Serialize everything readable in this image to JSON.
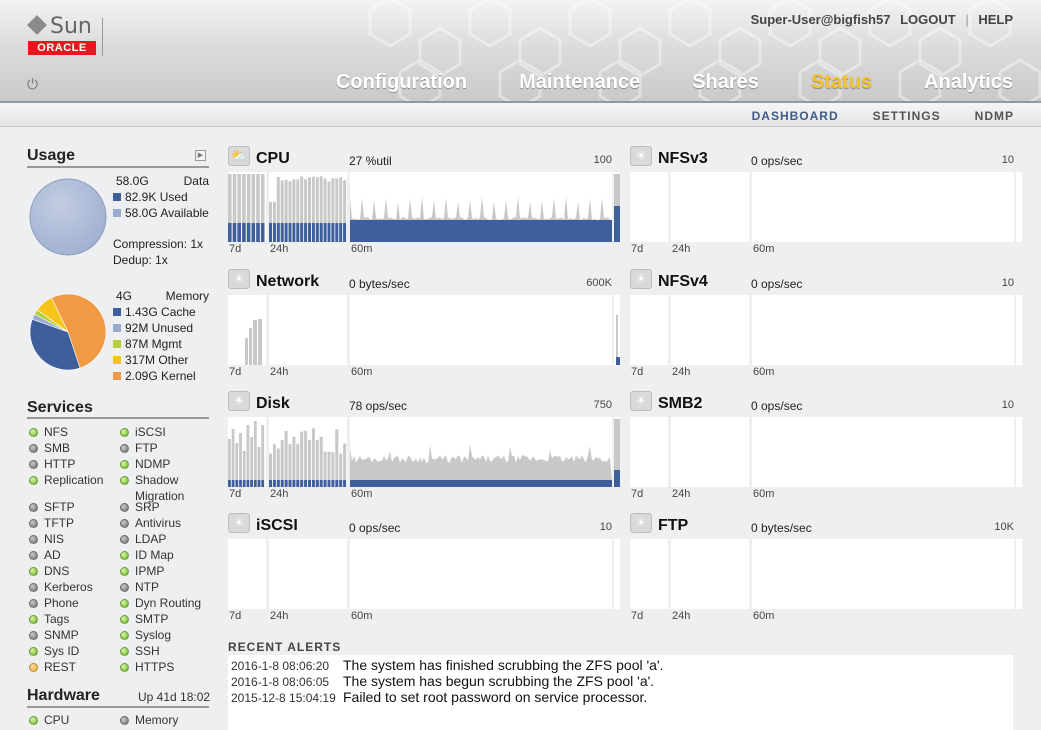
{
  "header": {
    "logo_top": "Sun",
    "logo_bottom": "ORACLE",
    "user": "Super-User@bigfish57",
    "logout": "LOGOUT",
    "help": "HELP",
    "separator": "|",
    "power_icon": "power-icon",
    "nav": [
      {
        "label": "Configuration",
        "active": false
      },
      {
        "label": "Maintenance",
        "active": false
      },
      {
        "label": "Shares",
        "active": false
      },
      {
        "label": "Status",
        "active": true
      },
      {
        "label": "Analytics",
        "active": false
      }
    ],
    "subnav": [
      {
        "label": "DASHBOARD",
        "active": true
      },
      {
        "label": "SETTINGS",
        "active": false
      },
      {
        "label": "NDMP",
        "active": false
      }
    ]
  },
  "usage": {
    "title": "Usage",
    "data": {
      "total": "58.0G",
      "label": "Data",
      "used": "82.9K Used",
      "available": "58.0G Available",
      "compression": "Compression: 1x",
      "dedup": "Dedup: 1x"
    },
    "memory": {
      "total": "4G",
      "label": "Memory",
      "items": [
        {
          "label": "1.43G Cache",
          "value": 1.43,
          "color": "#3e5f9c"
        },
        {
          "label": "92M Unused",
          "value": 0.092,
          "color": "#99abcf"
        },
        {
          "label": "87M Mgmt",
          "value": 0.087,
          "color": "#b6cf3a"
        },
        {
          "label": "317M Other",
          "value": 0.317,
          "color": "#f6c51c"
        },
        {
          "label": "2.09G Kernel",
          "value": 2.09,
          "color": "#f19a46"
        }
      ]
    }
  },
  "services": {
    "title": "Services",
    "left": [
      {
        "label": "NFS",
        "status": "green"
      },
      {
        "label": "SMB",
        "status": "gray"
      },
      {
        "label": "HTTP",
        "status": "gray"
      },
      {
        "label": "Replication",
        "status": "green"
      },
      {
        "label": "SFTP",
        "status": "gray"
      },
      {
        "label": "TFTP",
        "status": "gray"
      },
      {
        "label": "NIS",
        "status": "gray"
      },
      {
        "label": "AD",
        "status": "gray"
      },
      {
        "label": "DNS",
        "status": "green"
      },
      {
        "label": "Kerberos",
        "status": "gray"
      },
      {
        "label": "Phone",
        "status": "gray"
      },
      {
        "label": "Tags",
        "status": "green"
      },
      {
        "label": "SNMP",
        "status": "gray"
      },
      {
        "label": "Sys ID",
        "status": "green"
      },
      {
        "label": "REST",
        "status": "orange"
      }
    ],
    "right": [
      {
        "label": "iSCSI",
        "status": "green"
      },
      {
        "label": "FTP",
        "status": "gray"
      },
      {
        "label": "NDMP",
        "status": "green"
      },
      {
        "label": "Shadow",
        "label2": "Migration",
        "status": "green"
      },
      {
        "label": "SRP",
        "status": "gray"
      },
      {
        "label": "Antivirus",
        "status": "gray"
      },
      {
        "label": "LDAP",
        "status": "gray"
      },
      {
        "label": "ID Map",
        "status": "green"
      },
      {
        "label": "IPMP",
        "status": "green"
      },
      {
        "label": "NTP",
        "status": "gray"
      },
      {
        "label": "Dyn Routing",
        "status": "green"
      },
      {
        "label": "SMTP",
        "status": "green"
      },
      {
        "label": "Syslog",
        "status": "green"
      },
      {
        "label": "SSH",
        "status": "green"
      },
      {
        "label": "HTTPS",
        "status": "green"
      }
    ]
  },
  "hardware": {
    "title": "Hardware",
    "uptime": "Up 41d 18:02",
    "items": [
      {
        "label": "CPU",
        "status": "green"
      },
      {
        "label": "Memory",
        "status": "gray"
      }
    ]
  },
  "widgets": [
    {
      "key": "cpu",
      "icon": "partly-cloudy-icon",
      "title": "CPU",
      "value": "27 %util",
      "max": "100",
      "labels": [
        "7d",
        "24h",
        "60m"
      ]
    },
    {
      "key": "nfsv3",
      "icon": "sun-icon",
      "title": "NFSv3",
      "value": "0 ops/sec",
      "max": "10",
      "labels": [
        "7d",
        "24h",
        "60m"
      ]
    },
    {
      "key": "network",
      "icon": "sun-icon",
      "title": "Network",
      "value": "0 bytes/sec",
      "max": "600K",
      "labels": [
        "7d",
        "24h",
        "60m"
      ]
    },
    {
      "key": "nfsv4",
      "icon": "sun-icon",
      "title": "NFSv4",
      "value": "0 ops/sec",
      "max": "10",
      "labels": [
        "7d",
        "24h",
        "60m"
      ]
    },
    {
      "key": "disk",
      "icon": "sun-icon",
      "title": "Disk",
      "value": "78 ops/sec",
      "max": "750",
      "labels": [
        "7d",
        "24h",
        "60m"
      ]
    },
    {
      "key": "smb2",
      "icon": "sun-icon",
      "title": "SMB2",
      "value": "0 ops/sec",
      "max": "10",
      "labels": [
        "7d",
        "24h",
        "60m"
      ]
    },
    {
      "key": "iscsi",
      "icon": "sun-icon",
      "title": "iSCSI",
      "value": "0 ops/sec",
      "max": "10",
      "labels": [
        "7d",
        "24h",
        "60m"
      ]
    },
    {
      "key": "ftp",
      "icon": "sun-icon",
      "title": "FTP",
      "value": "0 bytes/sec",
      "max": "10K",
      "labels": [
        "7d",
        "24h",
        "60m"
      ]
    }
  ],
  "alerts": {
    "title": "RECENT ALERTS",
    "items": [
      {
        "time": "2016-1-8 08:06:20",
        "message": "The system has finished scrubbing the ZFS pool 'a'."
      },
      {
        "time": "2016-1-8 08:06:05",
        "message": "The system has begun scrubbing the ZFS pool 'a'."
      },
      {
        "time": "2015-12-8 15:04:19",
        "message": "Failed to set root password on service processor."
      }
    ]
  }
}
